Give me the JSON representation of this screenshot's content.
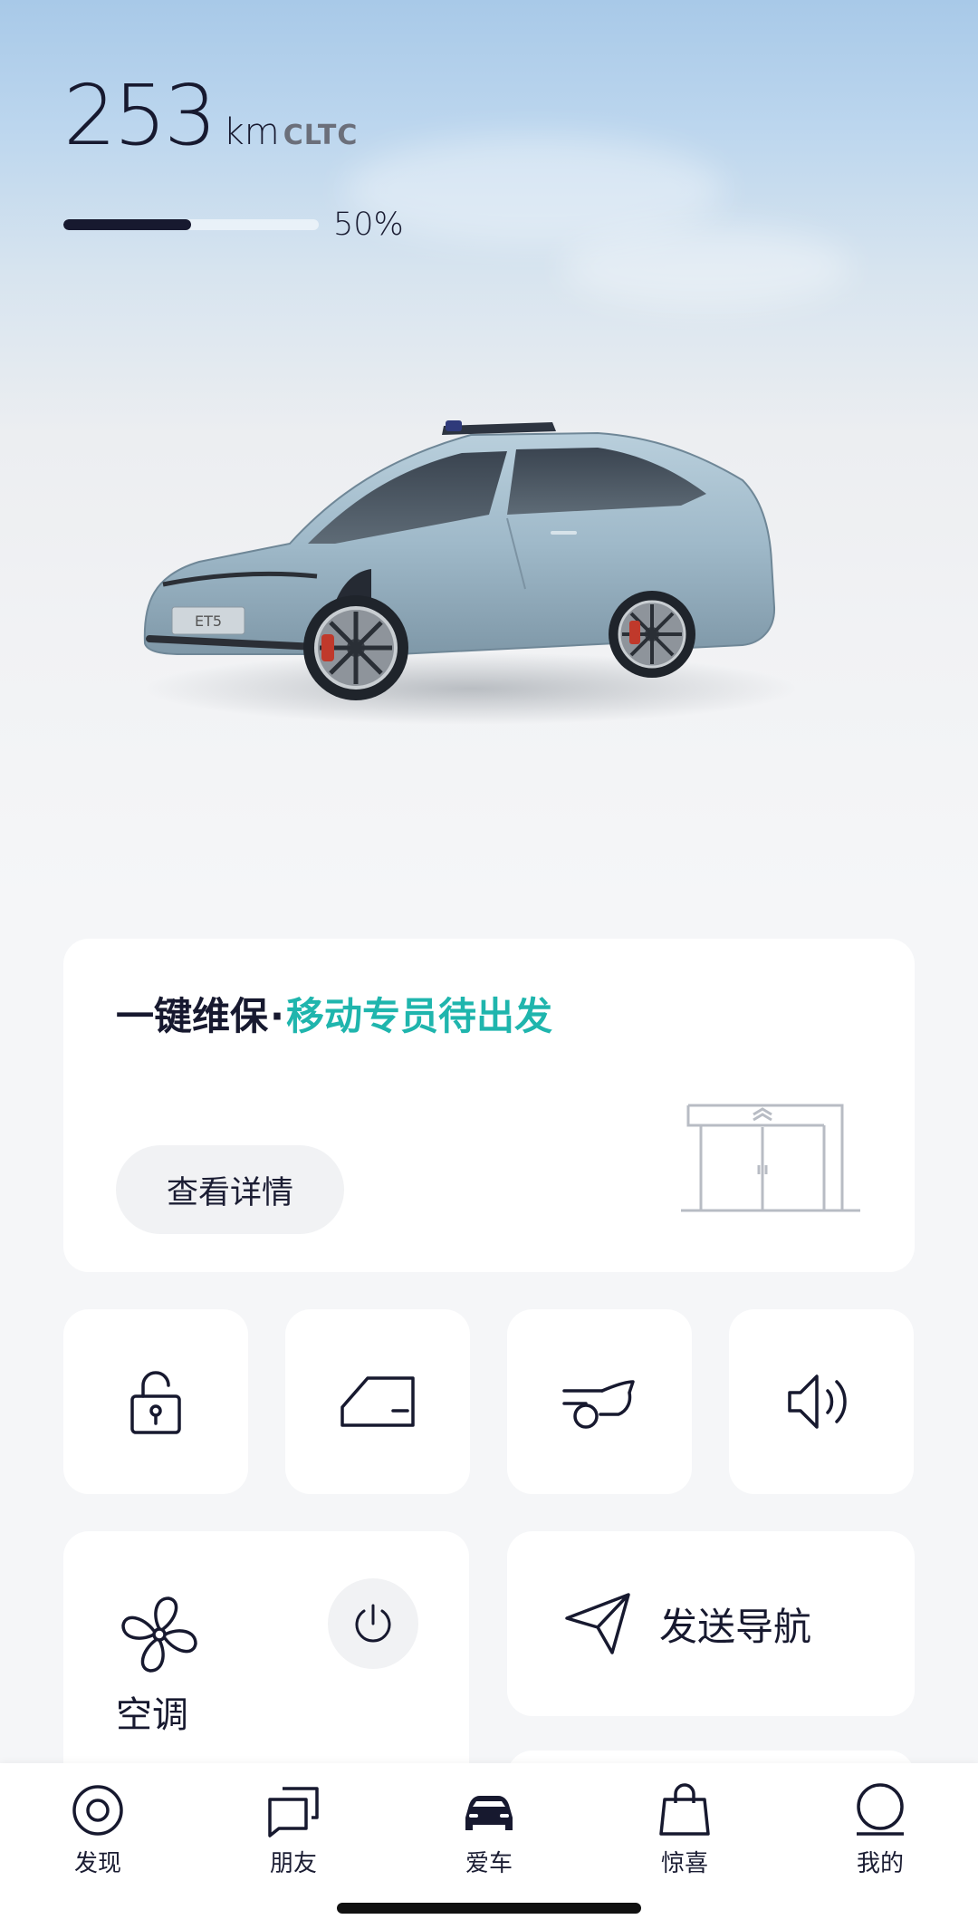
{
  "hero": {
    "range_value": "253",
    "range_unit": "km",
    "range_standard": "CLTC",
    "battery_percent": 50,
    "battery_label": "50%",
    "car_plate": "ET5"
  },
  "maintenance": {
    "title": "一键维保",
    "separator": "·",
    "status": "移动专员待出发",
    "detail_button": "查看详情",
    "status_color": "#1fb5ad"
  },
  "quick_controls": [
    {
      "icon": "lock-icon"
    },
    {
      "icon": "window-icon"
    },
    {
      "icon": "trunk-icon"
    },
    {
      "icon": "horn-icon"
    }
  ],
  "climate": {
    "label": "空调",
    "icon": "fan-icon",
    "power_icon": "power-icon"
  },
  "navigation": {
    "label": "发送导航",
    "icon": "send-arrow-icon"
  },
  "tabbar": {
    "items": [
      {
        "label": "发现",
        "icon": "discover-icon"
      },
      {
        "label": "朋友",
        "icon": "friends-icon"
      },
      {
        "label": "爱车",
        "icon": "car-icon",
        "active": true
      },
      {
        "label": "惊喜",
        "icon": "shopping-bag-icon"
      },
      {
        "label": "我的",
        "icon": "profile-icon"
      }
    ]
  },
  "colors": {
    "primary_text": "#17192f",
    "accent": "#1fb5ad"
  }
}
